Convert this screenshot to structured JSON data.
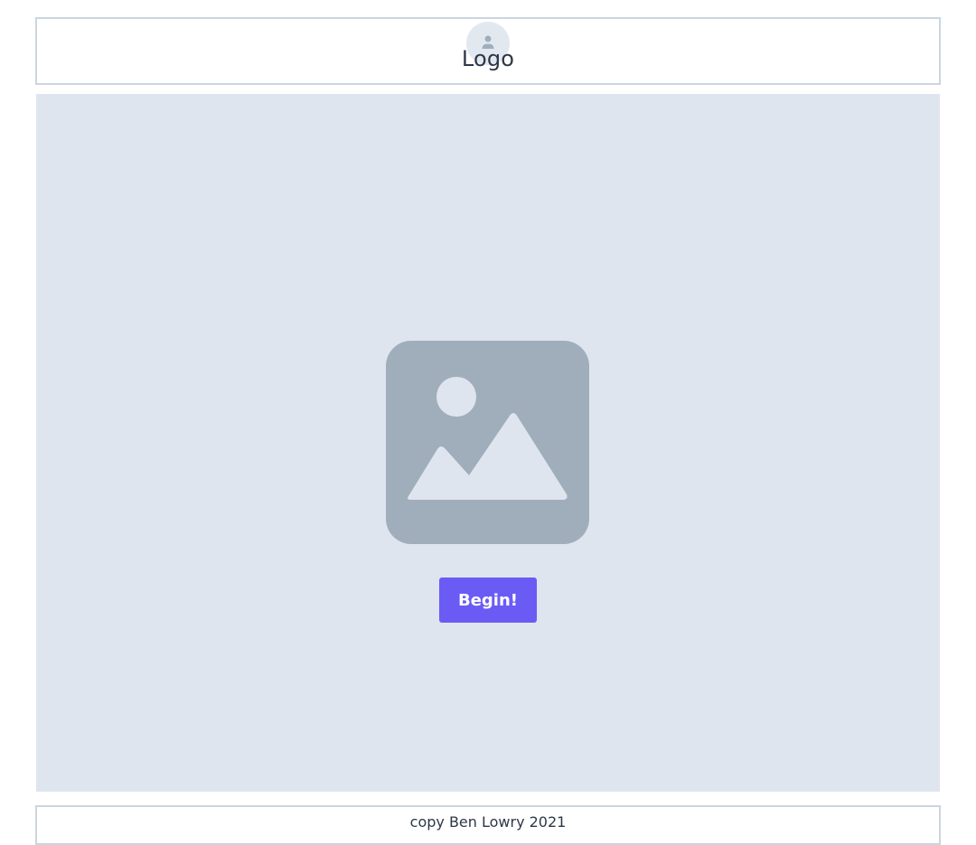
{
  "header": {
    "logo_label": "Logo",
    "avatar_icon": "user-icon"
  },
  "hero": {
    "image_icon": "image-placeholder-icon",
    "button_label": "Begin!"
  },
  "footer": {
    "copyright_text": "copy Ben Lowry 2021"
  },
  "colors": {
    "accent": "#6b5bf5",
    "hero_background": "#dfe5ee",
    "placeholder_gray": "#a0aebc",
    "border": "#cbd5e0",
    "text": "#2d3748"
  }
}
